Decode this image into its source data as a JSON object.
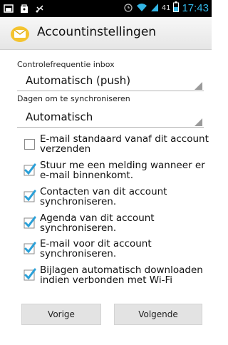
{
  "status_bar": {
    "time": "17:43",
    "battery_label": "41",
    "icons": [
      "screenshot-icon",
      "shopping-bag-icon",
      "usb-icon",
      "alarm-icon",
      "wifi-icon",
      "signal-icon",
      "battery-icon"
    ]
  },
  "header": {
    "title": "Accountinstellingen",
    "icon": "email-app-icon"
  },
  "inbox_frequency": {
    "label": "Controlefrequentie inbox",
    "value": "Automatisch (push)"
  },
  "sync_days": {
    "label": "Dagen om te synchroniseren",
    "value": "Automatisch"
  },
  "options": [
    {
      "line1": "E-mail standaard vanaf dit account",
      "line2": "verzenden",
      "checked": false
    },
    {
      "line1": "Stuur me een melding wanneer er",
      "line2": "e-mail binnenkomt.",
      "checked": true
    },
    {
      "line1": "Contacten van dit account",
      "line2": "synchroniseren.",
      "checked": true
    },
    {
      "line1": "Agenda van dit account",
      "line2": "synchroniseren.",
      "checked": true
    },
    {
      "line1": "E-mail voor dit account",
      "line2": "synchroniseren.",
      "checked": true
    },
    {
      "line1": "Bijlagen automatisch downloaden",
      "line2": "indien verbonden met Wi-Fi",
      "checked": true
    }
  ],
  "buttons": {
    "previous": "Vorige",
    "next": "Volgende"
  },
  "colors": {
    "accent": "#33b5e5",
    "check": "#2aa0d8"
  }
}
